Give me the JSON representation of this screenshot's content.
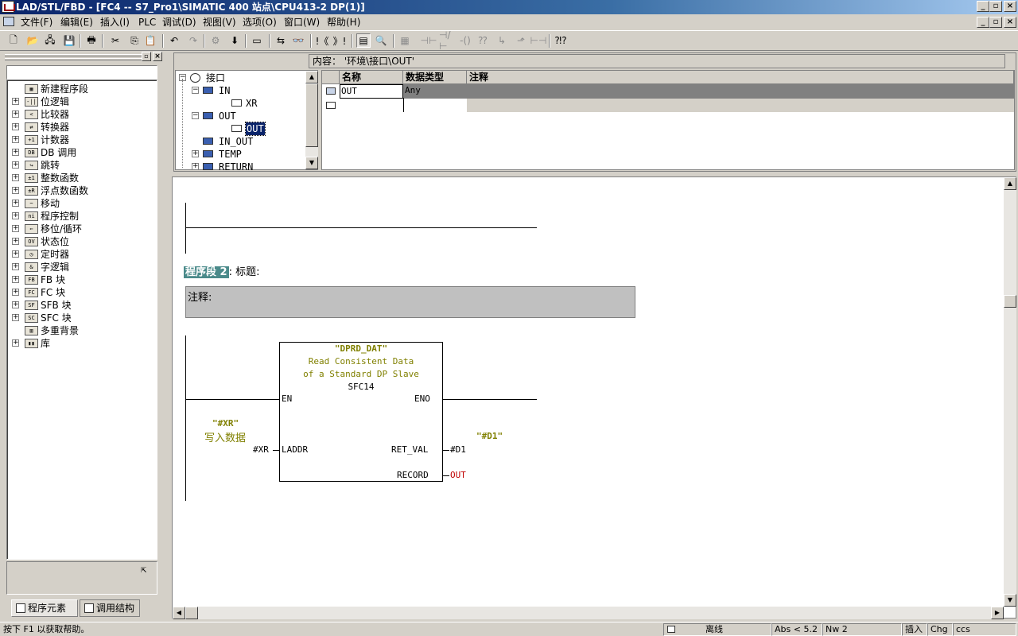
{
  "window": {
    "title": "LAD/STL/FBD  - [FC4 -- S7_Pro1\\SIMATIC 400 站点\\CPU413-2 DP(1)]",
    "controls": {
      "minimize": "_",
      "restore": "▫",
      "close": "×"
    }
  },
  "menubar": [
    "文件(F)",
    "编辑(E)",
    "插入(I)",
    "PLC",
    "调试(D)",
    "视图(V)",
    "选项(O)",
    "窗口(W)",
    "帮助(H)"
  ],
  "toolbar": [
    {
      "icon": "new-icon",
      "glyph": "🗋",
      "enabled": true
    },
    {
      "icon": "open-icon",
      "glyph": "📂",
      "enabled": true
    },
    {
      "icon": "accessible-nodes-icon",
      "glyph": "🖧",
      "enabled": true
    },
    {
      "icon": "save-icon",
      "glyph": "💾",
      "enabled": true
    },
    {
      "icon": "print-icon",
      "glyph": "🖶",
      "enabled": true
    },
    {
      "icon": "cut-icon",
      "glyph": "✂",
      "enabled": true
    },
    {
      "icon": "copy-icon",
      "glyph": "⎘",
      "enabled": true
    },
    {
      "icon": "paste-icon",
      "glyph": "📋",
      "enabled": true
    },
    {
      "icon": "undo-icon",
      "glyph": "↶",
      "enabled": true
    },
    {
      "icon": "redo-icon",
      "glyph": "↷",
      "enabled": false
    },
    {
      "icon": "compile-icon",
      "glyph": "⚙",
      "enabled": false
    },
    {
      "icon": "download-icon",
      "glyph": "⬇",
      "enabled": true
    },
    {
      "icon": "window-icon",
      "glyph": "▭",
      "enabled": true
    },
    {
      "icon": "online-icon",
      "glyph": "⇆",
      "enabled": true
    },
    {
      "icon": "monitor-icon",
      "glyph": "👓",
      "enabled": false
    },
    {
      "icon": "prev-network-icon",
      "glyph": "!《",
      "enabled": true
    },
    {
      "icon": "next-network-icon",
      "glyph": "》!",
      "enabled": true
    },
    {
      "icon": "overview-icon",
      "glyph": "▤",
      "enabled": true,
      "pressed": true
    },
    {
      "icon": "zoom-icon",
      "glyph": "🔍",
      "enabled": true
    },
    {
      "icon": "new-network-icon",
      "glyph": "▦",
      "enabled": false
    },
    {
      "icon": "no-contact-icon",
      "glyph": "⊣⊢",
      "enabled": false
    },
    {
      "icon": "nc-contact-icon",
      "glyph": "⊣/⊢",
      "enabled": false
    },
    {
      "icon": "coil-icon",
      "glyph": "-()",
      "enabled": false
    },
    {
      "icon": "empty-box-icon",
      "glyph": "⁇",
      "enabled": false
    },
    {
      "icon": "open-branch-icon",
      "glyph": "↳",
      "enabled": false
    },
    {
      "icon": "close-branch-icon",
      "glyph": "⬏",
      "enabled": false
    },
    {
      "icon": "connection-icon",
      "glyph": "⊢⊣",
      "enabled": false
    },
    {
      "icon": "help-icon",
      "glyph": "⁈?",
      "enabled": true
    }
  ],
  "program_elements": {
    "items": [
      {
        "label": "新建程序段",
        "icon": "new-network-icon",
        "glyph": "▦",
        "expandable": false
      },
      {
        "label": "位逻辑",
        "icon": "bit-logic-icon",
        "glyph": "-||",
        "expandable": true
      },
      {
        "label": "比较器",
        "icon": "comparator-icon",
        "glyph": "<",
        "expandable": true
      },
      {
        "label": "转换器",
        "icon": "converter-icon",
        "glyph": "⇄",
        "expandable": true
      },
      {
        "label": "计数器",
        "icon": "counter-icon",
        "glyph": "+1",
        "expandable": true
      },
      {
        "label": "DB 调用",
        "icon": "db-call-icon",
        "glyph": "DB",
        "expandable": true
      },
      {
        "label": "跳转",
        "icon": "jump-icon",
        "glyph": "↪",
        "expandable": true
      },
      {
        "label": "整数函数",
        "icon": "integer-function-icon",
        "glyph": "±1",
        "expandable": true
      },
      {
        "label": "浮点数函数",
        "icon": "float-function-icon",
        "glyph": "±R",
        "expandable": true
      },
      {
        "label": "移动",
        "icon": "move-icon",
        "glyph": "~",
        "expandable": true
      },
      {
        "label": "程序控制",
        "icon": "program-control-icon",
        "glyph": "ni",
        "expandable": true
      },
      {
        "label": "移位/循环",
        "icon": "shift-rotate-icon",
        "glyph": "⇐",
        "expandable": true
      },
      {
        "label": "状态位",
        "icon": "status-bits-icon",
        "glyph": "OV",
        "expandable": true
      },
      {
        "label": "定时器",
        "icon": "timer-icon",
        "glyph": "◷",
        "expandable": true
      },
      {
        "label": "字逻辑",
        "icon": "word-logic-icon",
        "glyph": "&",
        "expandable": true
      },
      {
        "label": "FB 块",
        "icon": "fb-block-icon",
        "glyph": "FB",
        "expandable": true
      },
      {
        "label": "FC 块",
        "icon": "fc-block-icon",
        "glyph": "FC",
        "expandable": true
      },
      {
        "label": "SFB 块",
        "icon": "sfb-block-icon",
        "glyph": "SF",
        "expandable": true
      },
      {
        "label": "SFC 块",
        "icon": "sfc-block-icon",
        "glyph": "SC",
        "expandable": true
      },
      {
        "label": "多重背景",
        "icon": "multi-instance-icon",
        "glyph": "▥",
        "expandable": false
      },
      {
        "label": "库",
        "icon": "library-icon",
        "glyph": "▮▮",
        "expandable": true
      }
    ],
    "tabs": [
      "程序元素",
      "调用结构"
    ],
    "active_tab": 0
  },
  "interface": {
    "content_path": "内容：  '环境\\接口\\OUT'",
    "tree": [
      {
        "label": "接口",
        "toggle": "−",
        "depth": 0
      },
      {
        "label": "IN",
        "toggle": "−",
        "depth": 1
      },
      {
        "label": "XR",
        "toggle": "",
        "depth": 2
      },
      {
        "label": "OUT",
        "toggle": "−",
        "depth": 1
      },
      {
        "label": "OUT",
        "toggle": "",
        "depth": 2,
        "selected": true
      },
      {
        "label": "IN_OUT",
        "toggle": "",
        "depth": 1
      },
      {
        "label": "TEMP",
        "toggle": "+",
        "depth": 1
      },
      {
        "label": "RETURN",
        "toggle": "+",
        "depth": 1
      }
    ],
    "columns": [
      "名称",
      "数据类型",
      "注释"
    ],
    "rows": [
      {
        "name": "OUT",
        "type": "Any",
        "comment": ""
      },
      {
        "name": "",
        "type": "",
        "comment": ""
      }
    ]
  },
  "editor": {
    "network": {
      "label": "程序段 2",
      "title_label": ": 标题:",
      "comment_label": "注释:"
    },
    "block": {
      "symbol": "\"DPRD_DAT\"",
      "desc1": "Read Consistent Data",
      "desc2": "of a Standard DP Slave",
      "name": "SFC14",
      "en": "EN",
      "eno": "ENO",
      "laddr": "LADDR",
      "ret_val": "RET_VAL",
      "record": "RECORD"
    },
    "params": {
      "laddr_symbol": "\"#XR\"",
      "laddr_comment": "写入数据",
      "laddr_operand": "#XR",
      "ret_symbol": "\"#D1\"",
      "ret_operand": "#D1",
      "record_operand": "OUT"
    }
  },
  "statusbar": {
    "help": "按下 F1 以获取帮助。",
    "mode": "离线",
    "abs": "Abs < 5.2",
    "nw": "Nw 2",
    "insert": "插入",
    "chg": "Chg",
    "ccs": "ccs"
  },
  "colors": {
    "titlebar_start": "#0a246a",
    "titlebar_end": "#a6caf0",
    "selection": "#0a246a",
    "network_label_bg": "#4a8a8a",
    "symbol_text": "#808000",
    "record_operand": "#c00000",
    "grid_highlight": "#808080"
  }
}
